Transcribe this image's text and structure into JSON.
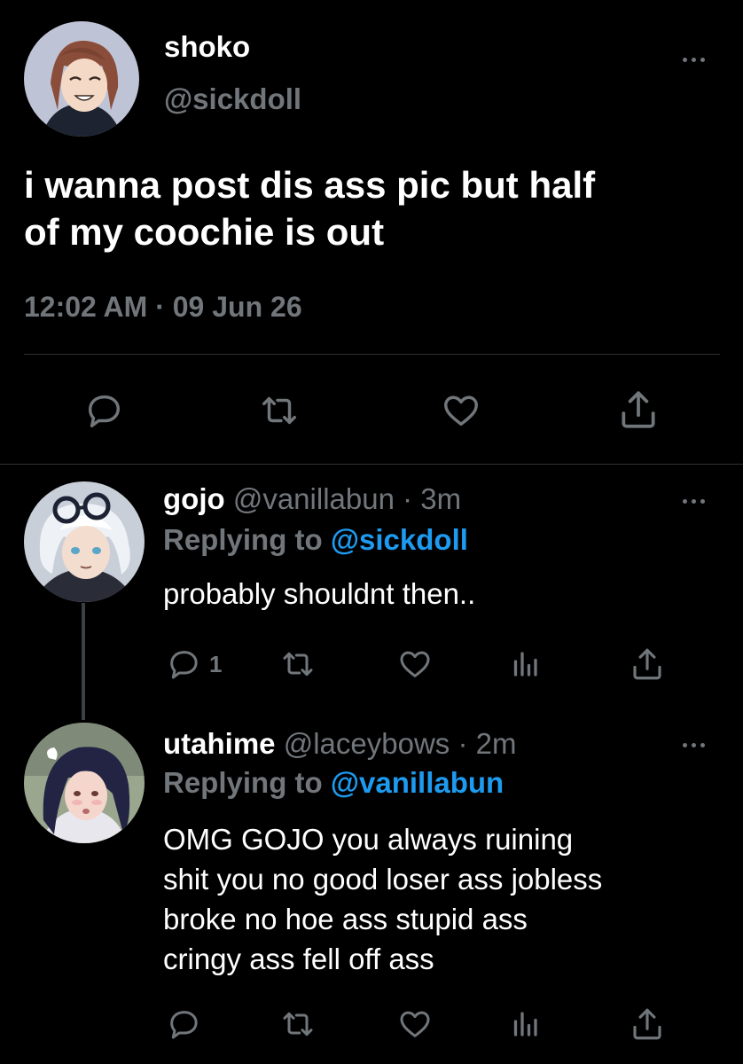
{
  "main_tweet": {
    "display_name": "shoko",
    "handle": "@sickdoll",
    "text_line1": "i wanna post dis ass pic but half",
    "text_line2": "of my coochie is out",
    "timestamp": "12:02 AM · 09 Jun 26",
    "actions": [
      "reply-icon",
      "retweet-icon",
      "like-icon",
      "share-icon"
    ]
  },
  "replies": [
    {
      "display_name": "gojo",
      "handle": "@vanillabun",
      "time": "· 3m",
      "replying_prefix": "Replying to",
      "replying_to": "@sickdoll",
      "text": "probably shouldnt then..",
      "reply_count": "1"
    },
    {
      "display_name": "utahime",
      "handle": "@laceybows",
      "time": "· 2m",
      "replying_prefix": "Replying to",
      "replying_to": "@vanillabun",
      "text_lines": [
        "OMG GOJO you always ruining",
        "shit you no good loser ass jobless",
        "broke no hoe ass stupid ass",
        "cringy ass fell off ass"
      ],
      "reply_count": ""
    }
  ],
  "colors": {
    "background": "#000000",
    "text": "#ffffff",
    "muted": "#71767b",
    "link": "#1d9bf0",
    "divider": "#2f3336"
  }
}
